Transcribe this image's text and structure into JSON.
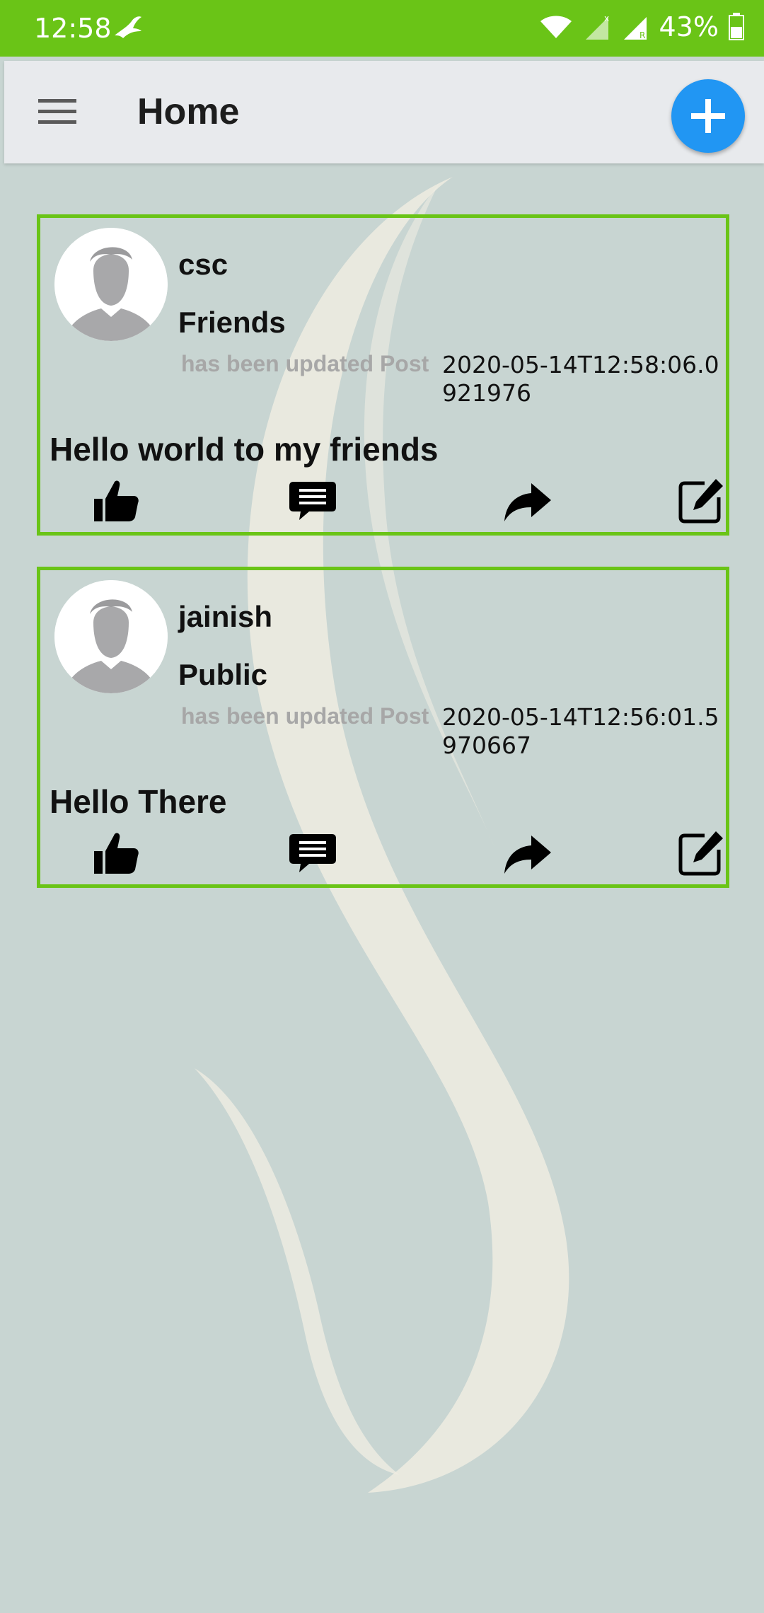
{
  "status_bar": {
    "time": "12:58",
    "battery": "43%",
    "color": "#6ac417"
  },
  "app_bar": {
    "title": "Home",
    "menu_icon": "hamburger-menu-icon",
    "add_icon": "plus-icon",
    "fab_color": "#2196f3"
  },
  "posts": [
    {
      "user": "csc",
      "privacy": "Friends",
      "updated_label": "has been updated Post",
      "timestamp": "2020-05-14T12:58:06.0921976",
      "text": "Hello world to my friends"
    },
    {
      "user": "jainish",
      "privacy": "Public",
      "updated_label": "has been updated Post",
      "timestamp": "2020-05-14T12:56:01.5970667",
      "text": "Hello There"
    }
  ],
  "icons": {
    "like": "thumbs-up-icon",
    "comment": "comment-icon",
    "share": "share-arrow-icon",
    "edit": "edit-icon"
  },
  "accent_color": "#6ac417"
}
